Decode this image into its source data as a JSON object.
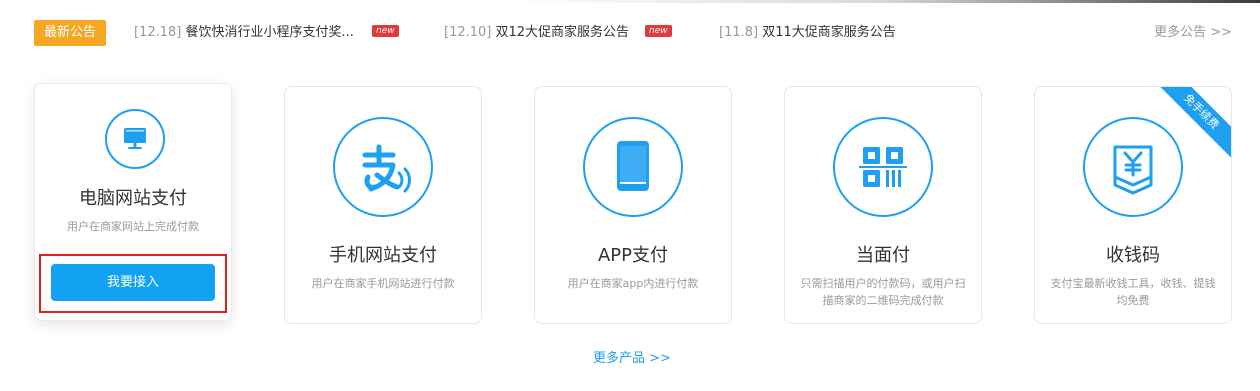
{
  "notice": {
    "badge": "最新公告",
    "items": [
      {
        "date": "[12.18]",
        "text": "餐饮快消行业小程序支付奖...",
        "tag": "new"
      },
      {
        "date": "[12.10]",
        "text": "双12大促商家服务公告",
        "tag": "new"
      },
      {
        "date": "[11.8]",
        "text": "双11大促商家服务公告",
        "tag": ""
      }
    ],
    "more": "更多公告 >>"
  },
  "cards": [
    {
      "title": "电脑网站支付",
      "desc": "用户在商家网站上完成付款",
      "icon": "computer-icon",
      "button": "我要接入"
    },
    {
      "title": "手机网站支付",
      "desc": "用户在商家手机网站进行付款",
      "icon": "alipay-logo-icon"
    },
    {
      "title": "APP支付",
      "desc": "用户在商家app内进行付款",
      "icon": "mobile-phone-icon"
    },
    {
      "title": "当面付",
      "desc": "只需扫描用户的付款码，或用户扫描商家的二维码完成付款",
      "icon": "qr-code-icon"
    },
    {
      "title": "收钱码",
      "desc": "支付宝最新收钱工具，收钱、提钱均免费",
      "icon": "yuan-code-icon",
      "ribbon": "免手续费"
    }
  ],
  "more_products": "更多产品 >>",
  "colors": {
    "accent": "#1e9ff2",
    "badge": "#f5a623",
    "new_tag": "#e5383b",
    "highlight_frame": "#e02020"
  }
}
